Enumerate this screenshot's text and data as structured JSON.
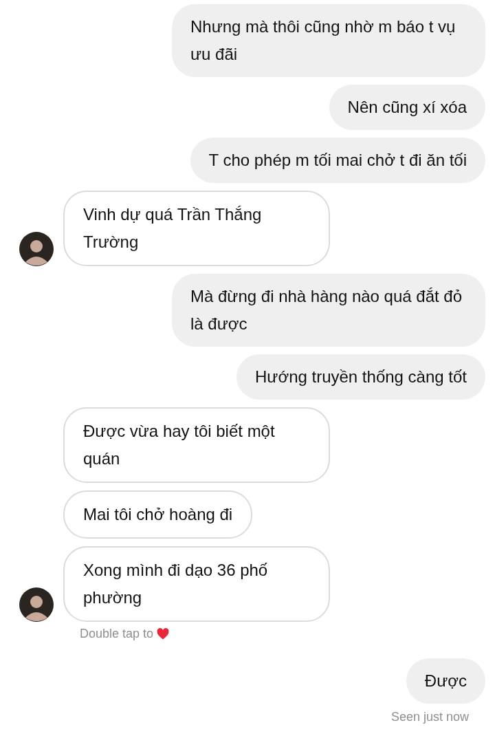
{
  "messages": [
    {
      "kind": "sent",
      "text": "Nhưng mà thôi cũng nhờ m báo t vụ ưu đãi"
    },
    {
      "kind": "sent",
      "text": "Nên cũng xí xóa"
    },
    {
      "kind": "sent",
      "text": "T cho phép m tối mai chở t đi ăn tối"
    },
    {
      "kind": "received",
      "text": "Vinh dự quá Trần Thắng Trường",
      "avatar": true
    },
    {
      "kind": "sent",
      "text": "Mà đừng đi nhà hàng nào quá đắt đỏ là được"
    },
    {
      "kind": "sent",
      "text": "Hướng truyền thống càng tốt"
    },
    {
      "kind": "received",
      "text": "Được vừa hay tôi biết một quán",
      "avatar": false
    },
    {
      "kind": "received",
      "text": "Mai tôi chở hoàng đi",
      "avatar": false
    },
    {
      "kind": "received",
      "text": "Xong mình đi dạo 36 phố phường",
      "avatar": true,
      "hint": "Double tap to"
    },
    {
      "kind": "sent",
      "text": "Được",
      "status": "Seen just now"
    }
  ]
}
